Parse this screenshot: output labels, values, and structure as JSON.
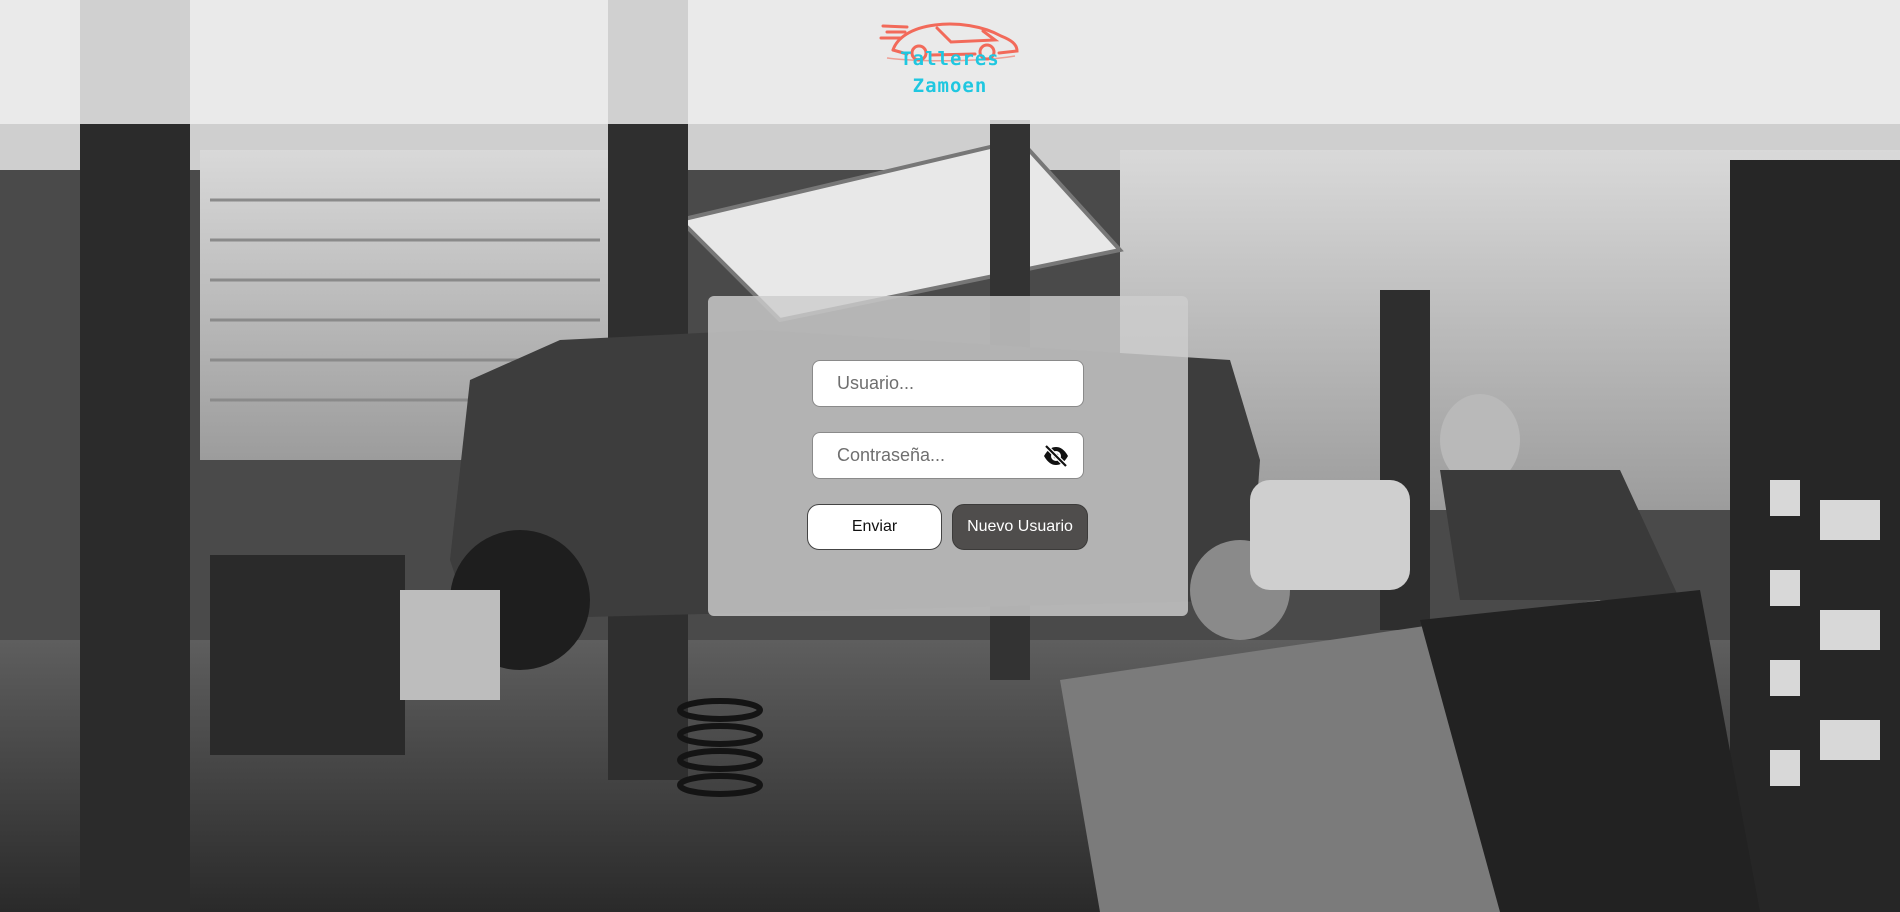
{
  "header": {
    "logo_line1": "Talleres",
    "logo_line2": "Zamoen",
    "logo_icon": "car-icon"
  },
  "login": {
    "username_placeholder": "Usuario...",
    "password_placeholder": "Contraseña...",
    "toggle_password_icon": "eye-slash-icon",
    "submit_label": "Enviar",
    "new_user_label": "Nuevo Usuario"
  },
  "colors": {
    "logo_car": "#f26a5a",
    "logo_text": "#1fc7e0",
    "new_user_button": "#4f4d4c"
  }
}
